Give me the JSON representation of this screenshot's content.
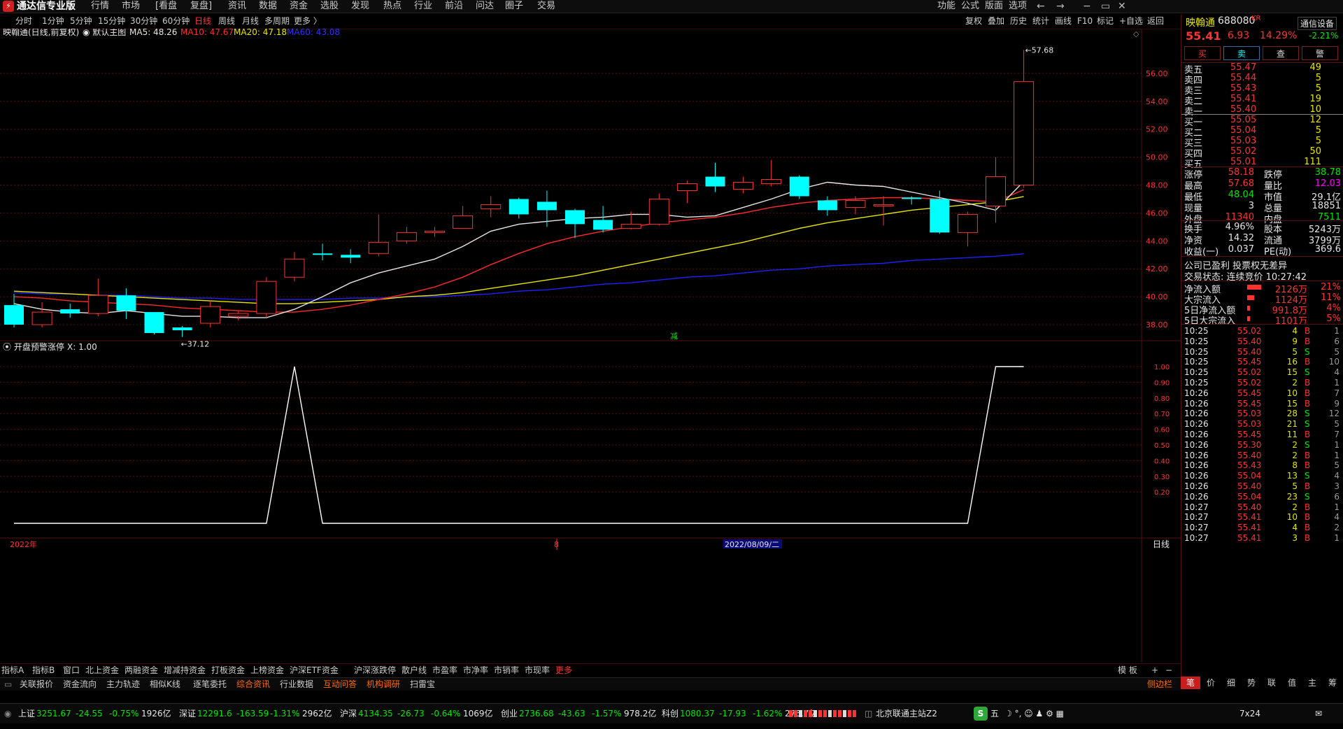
{
  "app": {
    "title": "通达信专业版",
    "logo_glyph": "⚡"
  },
  "menu": [
    "行情",
    "市场",
    "[看盘",
    "复盘]",
    "资讯",
    "数据",
    "资金",
    "选股",
    "发现",
    "热点",
    "行业",
    "前沿",
    "问达",
    "圈子",
    "交易"
  ],
  "right_menu": [
    "功能",
    "公式",
    "版面",
    "选项"
  ],
  "window_controls": [
    "←",
    "→",
    "−",
    "▭",
    "✕"
  ],
  "periods": [
    "分时",
    "1分钟",
    "5分钟",
    "15分钟",
    "30分钟",
    "60分钟",
    "日线",
    "周线",
    "月线",
    "多周期",
    "更多 〉"
  ],
  "active_period": "日线",
  "tools": [
    "复权",
    "叠加",
    "历史",
    "统计",
    "画线",
    "F10",
    "标记",
    "+自选",
    "返回"
  ],
  "chart_header": {
    "name": "映翰通(日线,前复权)",
    "template": "默认主图",
    "ma5": "MA5: 48.26",
    "ma10": "MA10: 47.67",
    "ma20": "MA20: 47.18",
    "ma60": "MA60: 43.08"
  },
  "indicator_header": {
    "name": "开盘预警涨停",
    "value": "X: 1.00"
  },
  "annotations": {
    "high": "57.68",
    "low": "37.12",
    "marker": "减",
    "year_label": "2022年",
    "cursor_date": "2022/08/09/二",
    "mid_label": "8",
    "period_label": "日线"
  },
  "colors": {
    "up": "#ff3232",
    "down": "#00ffff",
    "ma5": "#e6e6e6",
    "ma10": "#ff2a2a",
    "ma20": "#e6e600",
    "ma60": "#2020ff",
    "grid": "#5a1010",
    "indicator": "#ffffff"
  },
  "chart_data": {
    "type": "candlestick",
    "x": [
      "2022-06-20",
      "2022-06-21",
      "2022-06-22",
      "2022-06-23",
      "2022-06-24",
      "2022-06-27",
      "2022-06-28",
      "2022-06-29",
      "2022-06-30",
      "2022-07-01",
      "2022-07-04",
      "2022-07-05",
      "2022-07-06",
      "2022-07-07",
      "2022-07-08",
      "2022-07-11",
      "2022-07-12",
      "2022-07-13",
      "2022-07-14",
      "2022-07-15",
      "2022-07-18",
      "2022-07-19",
      "2022-07-20",
      "2022-07-21",
      "2022-07-22",
      "2022-07-25",
      "2022-07-26",
      "2022-07-27",
      "2022-07-28",
      "2022-07-29",
      "2022-08-01",
      "2022-08-02",
      "2022-08-03",
      "2022-08-04",
      "2022-08-05",
      "2022-08-08",
      "2022-08-09"
    ],
    "candles": [
      {
        "o": 39.4,
        "h": 40.2,
        "l": 37.8,
        "c": 38.0
      },
      {
        "o": 38.0,
        "h": 39.6,
        "l": 37.8,
        "c": 38.9
      },
      {
        "o": 39.1,
        "h": 39.5,
        "l": 38.5,
        "c": 38.8
      },
      {
        "o": 38.8,
        "h": 41.3,
        "l": 38.6,
        "c": 40.1
      },
      {
        "o": 40.1,
        "h": 40.6,
        "l": 38.4,
        "c": 39.0
      },
      {
        "o": 38.9,
        "h": 38.9,
        "l": 37.3,
        "c": 37.4
      },
      {
        "o": 37.8,
        "h": 37.9,
        "l": 37.12,
        "c": 37.6
      },
      {
        "o": 38.1,
        "h": 39.7,
        "l": 37.8,
        "c": 39.3
      },
      {
        "o": 38.6,
        "h": 39.0,
        "l": 38.3,
        "c": 38.8
      },
      {
        "o": 38.8,
        "h": 41.4,
        "l": 38.5,
        "c": 41.1
      },
      {
        "o": 41.4,
        "h": 43.2,
        "l": 41.1,
        "c": 42.7
      },
      {
        "o": 43.1,
        "h": 43.8,
        "l": 42.6,
        "c": 43.0
      },
      {
        "o": 43.0,
        "h": 43.4,
        "l": 42.4,
        "c": 42.8
      },
      {
        "o": 43.1,
        "h": 45.9,
        "l": 42.9,
        "c": 43.9
      },
      {
        "o": 44.0,
        "h": 45.0,
        "l": 43.8,
        "c": 44.6
      },
      {
        "o": 44.6,
        "h": 45.0,
        "l": 44.3,
        "c": 44.7
      },
      {
        "o": 44.9,
        "h": 46.5,
        "l": 44.9,
        "c": 45.8
      },
      {
        "o": 46.3,
        "h": 47.2,
        "l": 45.7,
        "c": 46.6
      },
      {
        "o": 47.0,
        "h": 47.1,
        "l": 45.6,
        "c": 45.9
      },
      {
        "o": 46.8,
        "h": 47.6,
        "l": 45.0,
        "c": 46.2
      },
      {
        "o": 46.2,
        "h": 46.3,
        "l": 44.2,
        "c": 45.2
      },
      {
        "o": 45.5,
        "h": 46.5,
        "l": 44.6,
        "c": 44.8
      },
      {
        "o": 44.9,
        "h": 46.1,
        "l": 44.8,
        "c": 45.2
      },
      {
        "o": 45.2,
        "h": 47.4,
        "l": 45.1,
        "c": 47.0
      },
      {
        "o": 47.6,
        "h": 48.3,
        "l": 46.7,
        "c": 48.1
      },
      {
        "o": 48.6,
        "h": 49.6,
        "l": 47.5,
        "c": 47.9
      },
      {
        "o": 47.7,
        "h": 48.6,
        "l": 47.4,
        "c": 48.2
      },
      {
        "o": 48.1,
        "h": 49.8,
        "l": 47.9,
        "c": 48.4
      },
      {
        "o": 48.6,
        "h": 48.7,
        "l": 47.0,
        "c": 47.2
      },
      {
        "o": 46.9,
        "h": 47.2,
        "l": 45.8,
        "c": 46.2
      },
      {
        "o": 46.4,
        "h": 47.2,
        "l": 45.9,
        "c": 46.9
      },
      {
        "o": 46.5,
        "h": 47.2,
        "l": 45.1,
        "c": 46.6
      },
      {
        "o": 47.1,
        "h": 47.2,
        "l": 46.6,
        "c": 47.0
      },
      {
        "o": 47.0,
        "h": 47.6,
        "l": 44.5,
        "c": 44.6
      },
      {
        "o": 44.6,
        "h": 46.1,
        "l": 43.6,
        "c": 45.9
      },
      {
        "o": 46.5,
        "h": 50.0,
        "l": 45.3,
        "c": 48.6
      },
      {
        "o": 48.0,
        "h": 57.68,
        "l": 47.8,
        "c": 55.41
      }
    ],
    "ma5": [
      39.5,
      39.1,
      38.9,
      38.8,
      39.0,
      38.8,
      38.6,
      38.6,
      38.5,
      38.5,
      39.1,
      40.0,
      41.0,
      41.7,
      42.2,
      42.7,
      43.6,
      44.7,
      45.2,
      45.4,
      45.6,
      45.7,
      45.9,
      45.9,
      45.7,
      45.8,
      46.4,
      47.0,
      47.7,
      48.2,
      48.0,
      47.9,
      47.5,
      47.1,
      46.7,
      46.2,
      48.26
    ],
    "ma10": [
      40.0,
      39.9,
      39.7,
      39.6,
      39.5,
      39.4,
      39.2,
      39.1,
      39.0,
      38.9,
      38.9,
      39.1,
      39.4,
      39.8,
      40.2,
      40.7,
      41.4,
      42.3,
      43.1,
      43.8,
      44.3,
      44.7,
      45.0,
      45.3,
      45.5,
      45.7,
      46.0,
      46.4,
      46.7,
      46.9,
      47.0,
      47.1,
      47.1,
      47.0,
      46.9,
      46.8,
      47.67
    ],
    "ma20": [
      40.4,
      40.3,
      40.2,
      40.1,
      40.0,
      39.9,
      39.8,
      39.7,
      39.6,
      39.5,
      39.5,
      39.6,
      39.7,
      39.8,
      40.0,
      40.1,
      40.3,
      40.6,
      40.9,
      41.2,
      41.5,
      41.9,
      42.3,
      42.7,
      43.1,
      43.5,
      43.9,
      44.4,
      44.9,
      45.3,
      45.6,
      45.9,
      46.2,
      46.4,
      46.6,
      46.8,
      47.18
    ],
    "ma60": [
      40.3,
      40.2,
      40.2,
      40.1,
      40.1,
      40.0,
      39.9,
      39.9,
      39.8,
      39.8,
      39.8,
      39.8,
      39.9,
      39.9,
      40.0,
      40.0,
      40.1,
      40.2,
      40.4,
      40.5,
      40.7,
      40.9,
      41.0,
      41.2,
      41.4,
      41.5,
      41.7,
      41.9,
      42.0,
      42.2,
      42.3,
      42.4,
      42.6,
      42.7,
      42.8,
      42.9,
      43.08
    ],
    "ylim": [
      37.0,
      58.5
    ],
    "yticks": [
      "56.00",
      "54.00",
      "52.00",
      "50.00",
      "48.00",
      "46.00",
      "44.00",
      "42.00",
      "40.00",
      "38.00"
    ],
    "indicator": {
      "name": "开盘预警涨停",
      "values": [
        0,
        0,
        0,
        0,
        0,
        0,
        0,
        0,
        0,
        0,
        1,
        0,
        0,
        0,
        0,
        0,
        0,
        0,
        0,
        0,
        0,
        0,
        0,
        0,
        0,
        0,
        0,
        0,
        0,
        0,
        0,
        0,
        0,
        0,
        0,
        1,
        1
      ],
      "ylim": [
        0,
        1.0
      ],
      "yticks": [
        "1.00",
        "0.90",
        "0.80",
        "0.70",
        "0.60",
        "0.50",
        "0.40",
        "0.30",
        "0.20"
      ]
    }
  },
  "stock": {
    "name": "映翰通",
    "code": "688080",
    "tag": "KR",
    "setting_button": "通信设备",
    "price": "55.41",
    "change": "6.93",
    "change_pct": "14.29%",
    "sector_pct": "-2.21%",
    "buttons": [
      "买",
      "卖",
      "查",
      "警"
    ],
    "sell": [
      {
        "label": "卖五",
        "price": "55.47",
        "vol": "49"
      },
      {
        "label": "卖四",
        "price": "55.44",
        "vol": "5"
      },
      {
        "label": "卖三",
        "price": "55.43",
        "vol": "5"
      },
      {
        "label": "卖二",
        "price": "55.41",
        "vol": "19"
      },
      {
        "label": "卖一",
        "price": "55.40",
        "vol": "10"
      }
    ],
    "buy": [
      {
        "label": "买一",
        "price": "55.05",
        "vol": "12"
      },
      {
        "label": "买二",
        "price": "55.04",
        "vol": "5"
      },
      {
        "label": "买三",
        "price": "55.03",
        "vol": "5"
      },
      {
        "label": "买四",
        "price": "55.02",
        "vol": "50"
      },
      {
        "label": "买五",
        "price": "55.01",
        "vol": "111"
      }
    ],
    "stats": [
      {
        "l1": "涨停",
        "v1": "58.18",
        "l2": "跌停",
        "v2": "38.78"
      },
      {
        "l1": "最高",
        "v1": "57.68",
        "l2": "量比",
        "v2": "12.03"
      },
      {
        "l1": "最低",
        "v1": "48.04",
        "l2": "市值",
        "v2": "29.1亿"
      },
      {
        "l1": "现量",
        "v1": "3",
        "l2": "总量",
        "v2": "18851"
      },
      {
        "l1": "外盘",
        "v1": "11340",
        "l2": "内盘",
        "v2": "7511"
      }
    ],
    "stats2": [
      {
        "l1": "换手",
        "v1": "4.96%",
        "l2": "股本",
        "v2": "5243万"
      },
      {
        "l1": "净资",
        "v1": "14.32",
        "l2": "流通",
        "v2": "3799万"
      },
      {
        "l1": "收益(一)",
        "v1": "0.037",
        "l2": "PE(动)",
        "v2": "369.6"
      }
    ],
    "notice1": "公司已盈利 投票权无差异",
    "notice2": "交易状态: 连续竞价 10:27:42",
    "flows": [
      {
        "label": "净流入额",
        "value": "2126万",
        "pct": "21%"
      },
      {
        "label": "大宗流入",
        "value": "1124万",
        "pct": "11%"
      },
      {
        "label": "5日净流入额",
        "value": "991.8万",
        "pct": "4%"
      },
      {
        "label": "5日大宗流入",
        "value": "1101万",
        "pct": "5%"
      }
    ],
    "flow_bar_fractions": [
      1.0,
      0.52,
      0.19,
      0.22
    ],
    "trades": [
      {
        "t": "10:25",
        "p": "55.02",
        "v": "4",
        "s": "B",
        "n": "1"
      },
      {
        "t": "10:25",
        "p": "55.40",
        "v": "9",
        "s": "B",
        "n": "6"
      },
      {
        "t": "10:25",
        "p": "55.40",
        "v": "5",
        "s": "S",
        "n": "5"
      },
      {
        "t": "10:25",
        "p": "55.45",
        "v": "16",
        "s": "B",
        "n": "10"
      },
      {
        "t": "10:25",
        "p": "55.02",
        "v": "15",
        "s": "S",
        "n": "4"
      },
      {
        "t": "10:25",
        "p": "55.02",
        "v": "2",
        "s": "B",
        "n": "1"
      },
      {
        "t": "10:26",
        "p": "55.45",
        "v": "10",
        "s": "B",
        "n": "7"
      },
      {
        "t": "10:26",
        "p": "55.45",
        "v": "15",
        "s": "B",
        "n": "9"
      },
      {
        "t": "10:26",
        "p": "55.03",
        "v": "28",
        "s": "S",
        "n": "12"
      },
      {
        "t": "10:26",
        "p": "55.03",
        "v": "21",
        "s": "S",
        "n": "5"
      },
      {
        "t": "10:26",
        "p": "55.45",
        "v": "11",
        "s": "B",
        "n": "7"
      },
      {
        "t": "10:26",
        "p": "55.30",
        "v": "2",
        "s": "S",
        "n": "1"
      },
      {
        "t": "10:26",
        "p": "55.40",
        "v": "2",
        "s": "B",
        "n": "1"
      },
      {
        "t": "10:26",
        "p": "55.43",
        "v": "8",
        "s": "B",
        "n": "5"
      },
      {
        "t": "10:26",
        "p": "55.04",
        "v": "13",
        "s": "S",
        "n": "4"
      },
      {
        "t": "10:26",
        "p": "55.40",
        "v": "5",
        "s": "B",
        "n": "3"
      },
      {
        "t": "10:26",
        "p": "55.04",
        "v": "23",
        "s": "S",
        "n": "6"
      },
      {
        "t": "10:27",
        "p": "55.40",
        "v": "2",
        "s": "B",
        "n": "1"
      },
      {
        "t": "10:27",
        "p": "55.41",
        "v": "10",
        "s": "B",
        "n": "4"
      },
      {
        "t": "10:27",
        "p": "55.41",
        "v": "4",
        "s": "B",
        "n": "2"
      },
      {
        "t": "10:27",
        "p": "55.41",
        "v": "3",
        "s": "B",
        "n": "1"
      }
    ],
    "page_tabs": [
      "笔",
      "价",
      "细",
      "势",
      "联",
      "值",
      "主",
      "筹"
    ]
  },
  "bottom_tabs": [
    "指标A",
    "指标B",
    "窗口",
    "北上资金",
    "两融资金",
    "增减持资金",
    "打板资金",
    "上榜资金",
    "沪深ETF资金",
    "沪深涨跌停",
    "散户线",
    "市盈率",
    "市净率",
    "市销率",
    "市现率",
    "更多"
  ],
  "bottom_tabs_right": [
    "模 板",
    "+",
    "−"
  ],
  "bottom_bar2": [
    "关联报价",
    "资金流向",
    "主力轨迹",
    "相似K线",
    "逐笔委托",
    "综合资讯",
    "行业数据",
    "互动问答",
    "机构调研",
    "扫雷宝"
  ],
  "bottom_bar2_right": "侧边栏",
  "status": {
    "indices": [
      {
        "name": "上证",
        "value": "3251.67",
        "chg": "-24.55",
        "pct": "-0.75%",
        "amt": "1926亿"
      },
      {
        "name": "深证",
        "value": "12291.6",
        "chg": "-163.59",
        "pct": "-1.31%",
        "amt": "2962亿"
      },
      {
        "name": "沪深",
        "value": "4134.35",
        "chg": "-26.73",
        "pct": "-0.64%",
        "amt": "1069亿"
      },
      {
        "name": "创业",
        "value": "2736.68",
        "chg": "-43.63",
        "pct": "-1.57%",
        "amt": "978.2亿"
      },
      {
        "name": "科创",
        "value": "1080.37",
        "chg": "-17.93",
        "pct": "-1.62%",
        "amt": "276.7亿"
      }
    ],
    "server": "北京联通主站Z2",
    "ime": "五",
    "clock": "7x24"
  }
}
